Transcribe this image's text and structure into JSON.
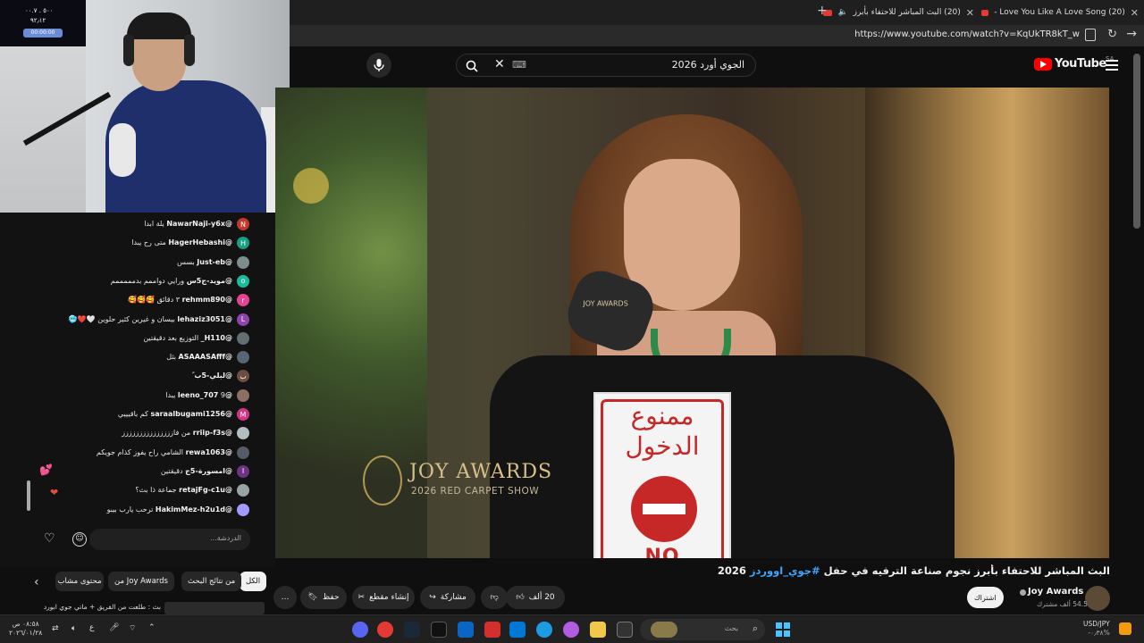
{
  "browser": {
    "tabs": [
      {
        "title": "(20) البث المباشر للاحتفاء بأبرز",
        "active": true
      },
      {
        "title": "(20) Love You Like A Love Song -",
        "active": false
      }
    ],
    "new_tab": "+",
    "url": "https://www.youtube.com/watch?v=KqUkTR8kT_w"
  },
  "youtube": {
    "logo": "YouTube",
    "region": "SA",
    "search_query": "الجوي أورد 2026",
    "keyboard_glyph": "⌨"
  },
  "webcam": {
    "overlay_line1": "٥٠٠ . ٠٠.٧",
    "overlay_line2": "٩٢٫١٢",
    "overlay_line3": "00:00:00"
  },
  "chat": {
    "messages": [
      {
        "user": "@NawarNaji-y6x",
        "text": "يلة ابدا",
        "avatar": "N",
        "color": "#c0392b"
      },
      {
        "user": "@HagerHebashi",
        "text": "متى رح يبدا",
        "avatar": "H",
        "color": "#16a085"
      },
      {
        "user": "@Just-eb",
        "text": "بسس",
        "avatar": "",
        "color": "#7f8c8d"
      },
      {
        "user": "@مويد-ج5س",
        "text": "ورايي دواممم بدمممممم",
        "avatar": "o",
        "color": "#1abc9c"
      },
      {
        "user": "@rehmm890",
        "text": "٣ دقائق 🥰🥰🥰",
        "avatar": "r",
        "color": "#e84393"
      },
      {
        "user": "@lehaziz3051",
        "text": "بيسان و غيرين كثير حلوين 🤍❤️🥶",
        "avatar": "L",
        "color": "#8e44ad"
      },
      {
        "user": "@H110_",
        "text": "التوزيع بعد دقيقتين",
        "avatar": "",
        "color": "#636e72"
      },
      {
        "user": "@ASAAASAfff",
        "text": "بثل",
        "avatar": "",
        "color": "#576574"
      },
      {
        "user": "@لبلي-5ب",
        "text": "ً",
        "avatar": "ب",
        "color": "#6d4c41"
      },
      {
        "user": "@leeno_707",
        "text": "9 يبدا",
        "avatar": "",
        "color": "#8d6e63"
      },
      {
        "user": "@saraalbugami1256",
        "text": "كم باقيييي",
        "avatar": "M",
        "color": "#d63384"
      },
      {
        "user": "@rriip-f3s",
        "text": "من فاززززززززززززززز",
        "avatar": "",
        "color": "#b2bec3"
      },
      {
        "user": "@rewa1063",
        "text": "الشامي راح يفوز كذام جويكم",
        "avatar": "",
        "color": "#535c68"
      },
      {
        "user": "@امسورة-5ج",
        "text": "دقيقتين",
        "avatar": "I",
        "color": "#6c3483"
      },
      {
        "user": "@retajFg-c1u",
        "text": "جماعة ذا بث؟",
        "avatar": "",
        "color": "#95a5a6"
      },
      {
        "user": "@HakimMez-h2u1d",
        "text": "ترحب يارب بيبو",
        "avatar": "",
        "color": "#a29bfe"
      }
    ],
    "input_placeholder": "الدردشة..."
  },
  "chips": [
    "الكل",
    "من نتائج البحث",
    "من Joy Awards",
    "محتوى مشاب"
  ],
  "up_next_snippet": "بث : طلعت من الفريق + ماتي جوي ابورد",
  "video": {
    "brand_line1": "JOY AWARDS",
    "brand_line2": "2026 RED CARPET SHOW",
    "mic_label": "JOY AWARDS",
    "sign_text": "ممنوع الدخول",
    "sign_en": "NO ENTRY",
    "title_prefix": "البث المباشر للاحتفاء بأبرز نجوم صناعة الترفيه في حفل ",
    "title_hashtag": "#جوي_اووردز",
    "title_suffix": " 2026",
    "channel": "Joy Awards",
    "subscribers": "54.5 ألف مشترك",
    "subscribe_label": "اشتراك",
    "likes": "20 ألف",
    "share": "مشاركة",
    "clip": "إنشاء مقطع",
    "save": "حفظ",
    "more": "…"
  },
  "taskbar": {
    "time": "٠٨:٥٨ ص",
    "date": "٢٠٢٦/٠١/٢٨",
    "lang": "ع",
    "search_placeholder": "بحث",
    "currency_pair": "USD/JPY",
    "currency_change": "-٠٫٣٨%"
  }
}
